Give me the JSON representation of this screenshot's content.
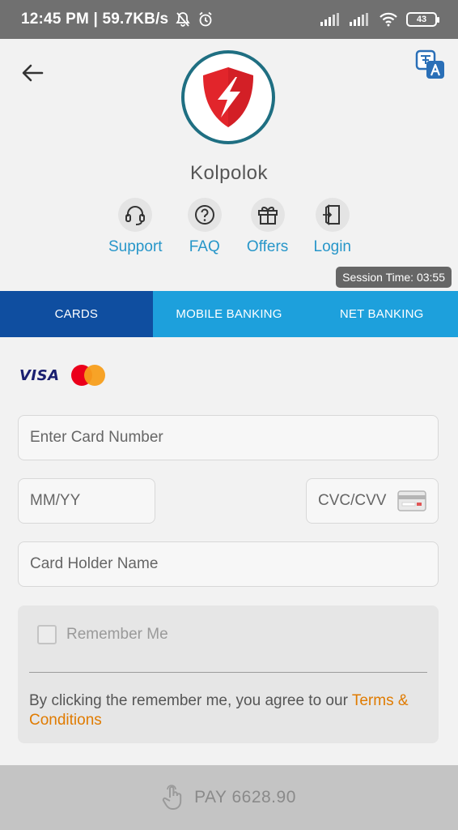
{
  "status_bar": {
    "text": "12:45 PM | 59.7KB/s",
    "battery": "43"
  },
  "header": {
    "merchant_name": "Kolpolok",
    "quick_links": [
      {
        "label": "Support",
        "icon": "headset-icon"
      },
      {
        "label": "FAQ",
        "icon": "question-icon"
      },
      {
        "label": "Offers",
        "icon": "gift-icon"
      },
      {
        "label": "Login",
        "icon": "login-door-icon"
      }
    ],
    "session_time": "Session Time: 03:55"
  },
  "tabs": [
    {
      "label": "CARDS",
      "active": true
    },
    {
      "label": "MOBILE BANKING",
      "active": false
    },
    {
      "label": "NET BANKING",
      "active": false
    }
  ],
  "card_form": {
    "brand_visa": "VISA",
    "card_number_placeholder": "Enter Card Number",
    "expiry_placeholder": "MM/YY",
    "cvc_placeholder": "CVC/CVV",
    "holder_placeholder": "Card Holder Name",
    "remember_label": "Remember Me",
    "remember_checked": false,
    "terms_prefix": "By clicking the remember me, you agree to our ",
    "terms_link": "Terms & Conditions"
  },
  "pay_button": {
    "label": "PAY 6628.90"
  },
  "colors": {
    "tab_active": "#0f4ea0",
    "tab_inactive": "#1da0dc",
    "link": "#2796c9",
    "terms": "#e07b00",
    "logo_red": "#e2252b"
  }
}
